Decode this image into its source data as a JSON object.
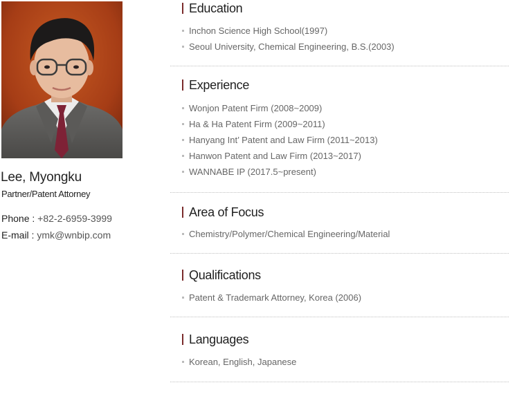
{
  "profile": {
    "name": "Lee, Myongku",
    "role": "Partner/Patent Attorney",
    "phone_label": "Phone : ",
    "phone": "+82-2-6959-3999",
    "email_label": "E-mail : ",
    "email": "ymk@wnbip.com",
    "photo_icon": "person-portrait-icon"
  },
  "colors": {
    "title_bar": "#7a2a2a",
    "photo_bg": "#b2471b",
    "bullet": "#bbbbbb"
  },
  "sections": [
    {
      "title": "Education",
      "items": [
        "Inchon Science High School(1997)",
        "Seoul University, Chemical Engineering, B.S.(2003)"
      ]
    },
    {
      "title": "Experience",
      "items": [
        "Wonjon Patent Firm (2008~2009)",
        "Ha & Ha Patent Firm (2009~2011)",
        "Hanyang Int’ Patent and Law Firm (2011~2013)",
        "Hanwon Patent and Law Firm (2013~2017)",
        "WANNABE IP (2017.5~present)"
      ]
    },
    {
      "title": "Area of Focus",
      "items": [
        "Chemistry/Polymer/Chemical Engineering/Material"
      ]
    },
    {
      "title": "Qualifications",
      "items": [
        "Patent & Trademark Attorney, Korea (2006)"
      ]
    },
    {
      "title": "Languages",
      "items": [
        "Korean, English, Japanese"
      ]
    }
  ]
}
